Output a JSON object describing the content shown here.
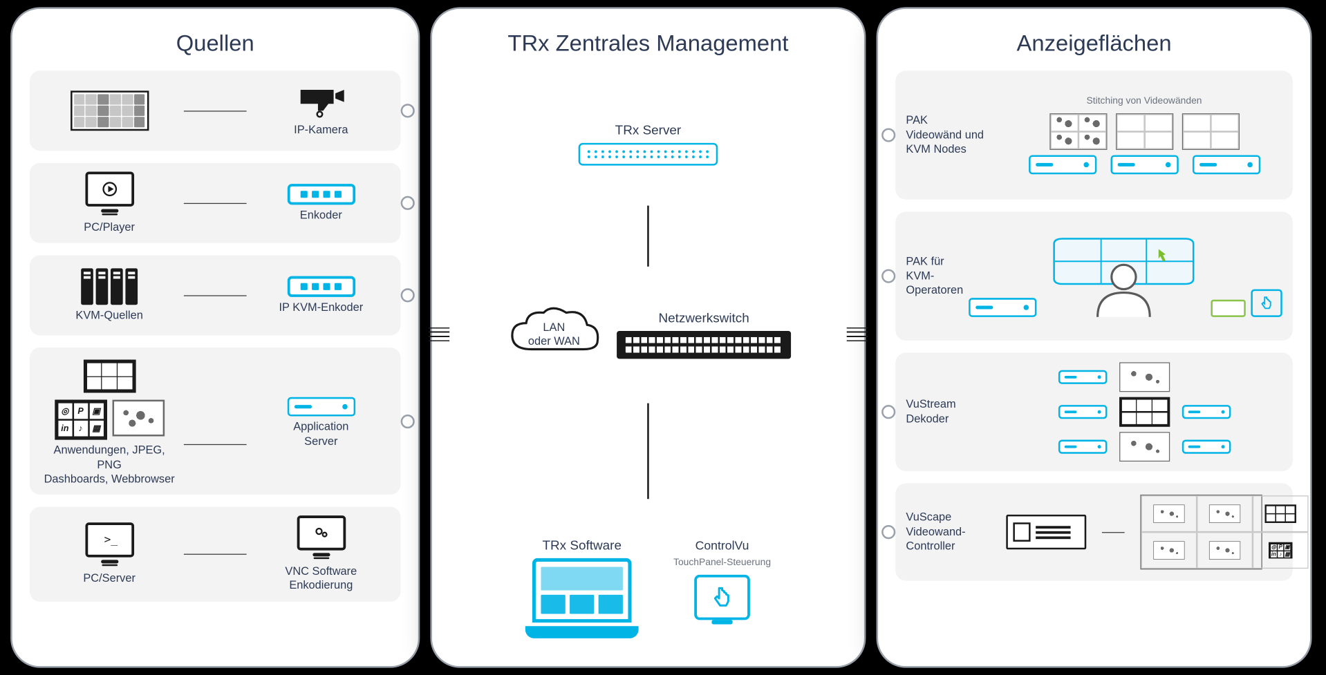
{
  "panels": {
    "left_title": "Quellen",
    "mid_title": "TRx Zentrales Management",
    "right_title": "Anzeigeflächen"
  },
  "sources": {
    "row1_left": "",
    "row1_right": "IP-Kamera",
    "row2_left": "PC/Player",
    "row2_right": "Enkoder",
    "row3_left": "KVM-Quellen",
    "row3_right": "IP KVM-Enkoder",
    "row4_left": "Anwendungen, JPEG, PNG\nDashboards, Webbrowser",
    "row4_right": "Application\nServer",
    "row5_left": "PC/Server",
    "row5_right": "VNC Software Enkodierung"
  },
  "middle": {
    "server_label": "TRx Server",
    "switch_label": "Netzwerkswitch",
    "cloud_line1": "LAN",
    "cloud_line2": "oder WAN",
    "software_label": "TRx Software",
    "controlvu_line1": "ControlVu",
    "controlvu_line2": "TouchPanel-Steuerung"
  },
  "displays": {
    "stitching_header": "Stitching von Videowänden",
    "row1_label": "PAK\nVideowänd und\nKVM Nodes",
    "row2_label": "PAK für\nKVM-Operatoren",
    "row3_label": "VuStream\nDekoder",
    "row4_label": "VuScape\nVideowand-Controller"
  }
}
